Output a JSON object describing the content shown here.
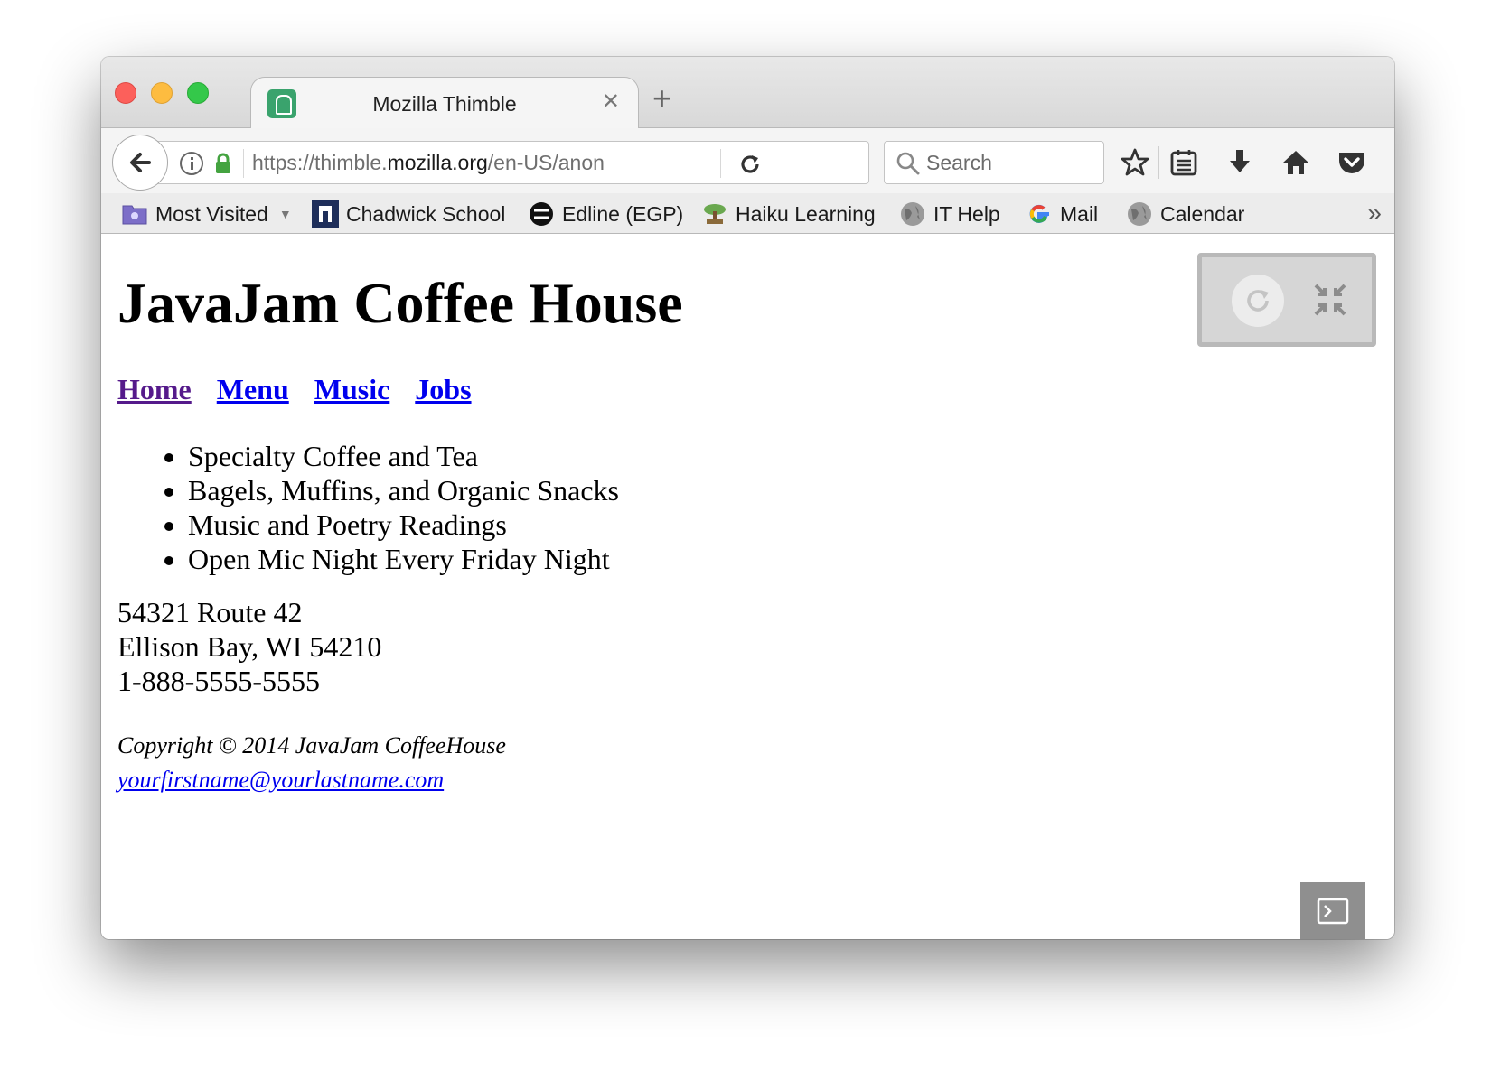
{
  "tab": {
    "title": "Mozilla Thimble",
    "close_glyph": "✕",
    "new_tab_glyph": "+"
  },
  "navbar": {
    "url_prefix": "https://thimble.",
    "url_host": "mozilla.org",
    "url_path": "/en-US/anon",
    "search_placeholder": "Search"
  },
  "bookmarks": [
    {
      "label": "Most Visited",
      "icon": "folder-icon"
    },
    {
      "label": "Chadwick School",
      "icon": "chadwick-icon"
    },
    {
      "label": "Edline (EGP)",
      "icon": "edline-icon"
    },
    {
      "label": "Haiku Learning",
      "icon": "bonsai-icon"
    },
    {
      "label": "IT Help",
      "icon": "globe-icon"
    },
    {
      "label": "Mail",
      "icon": "google-icon"
    },
    {
      "label": "Calendar",
      "icon": "globe-icon"
    }
  ],
  "bookmarks_overflow_glyph": "»",
  "page": {
    "title": "JavaJam Coffee House",
    "nav": [
      "Home",
      "Menu",
      "Music",
      "Jobs"
    ],
    "features": [
      "Specialty Coffee and Tea",
      "Bagels, Muffins, and Organic Snacks",
      "Music and Poetry Readings",
      "Open Mic Night Every Friday Night"
    ],
    "address": [
      "54321 Route 42",
      "Ellison Bay, WI 54210",
      "1-888-5555-5555"
    ],
    "copyright": "Copyright © 2014 JavaJam CoffeeHouse",
    "email": "yourfirstname@yourlastname.com"
  }
}
